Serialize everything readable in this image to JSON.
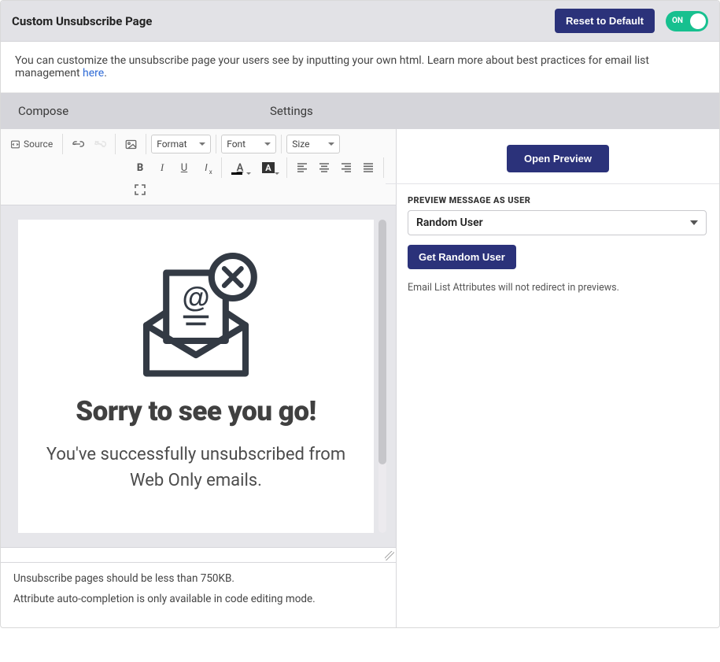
{
  "header": {
    "title": "Custom Unsubscribe Page",
    "reset_button": "Reset to Default",
    "toggle_label": "ON",
    "toggle_state": true
  },
  "info": {
    "text": "You can customize the unsubscribe page your users see by inputting your own html. Learn more about best practices for email list management ",
    "link_text": "here",
    "period": "."
  },
  "tabs": {
    "compose": "Compose",
    "settings": "Settings"
  },
  "toolbar": {
    "source": "Source",
    "format": "Format",
    "font": "Font",
    "size": "Size"
  },
  "editor": {
    "heading": "Sorry to see you go!",
    "subtext": "You've successfully unsubscribed from Web Only emails."
  },
  "notes": {
    "line1": "Unsubscribe pages should be less than 750KB.",
    "line2": "Attribute auto-completion is only available in code editing mode."
  },
  "settings": {
    "open_preview": "Open Preview",
    "preview_label": "PREVIEW MESSAGE AS USER",
    "user_select": "Random User",
    "get_random_user": "Get Random User",
    "hint": "Email List Attributes will not redirect in previews."
  }
}
